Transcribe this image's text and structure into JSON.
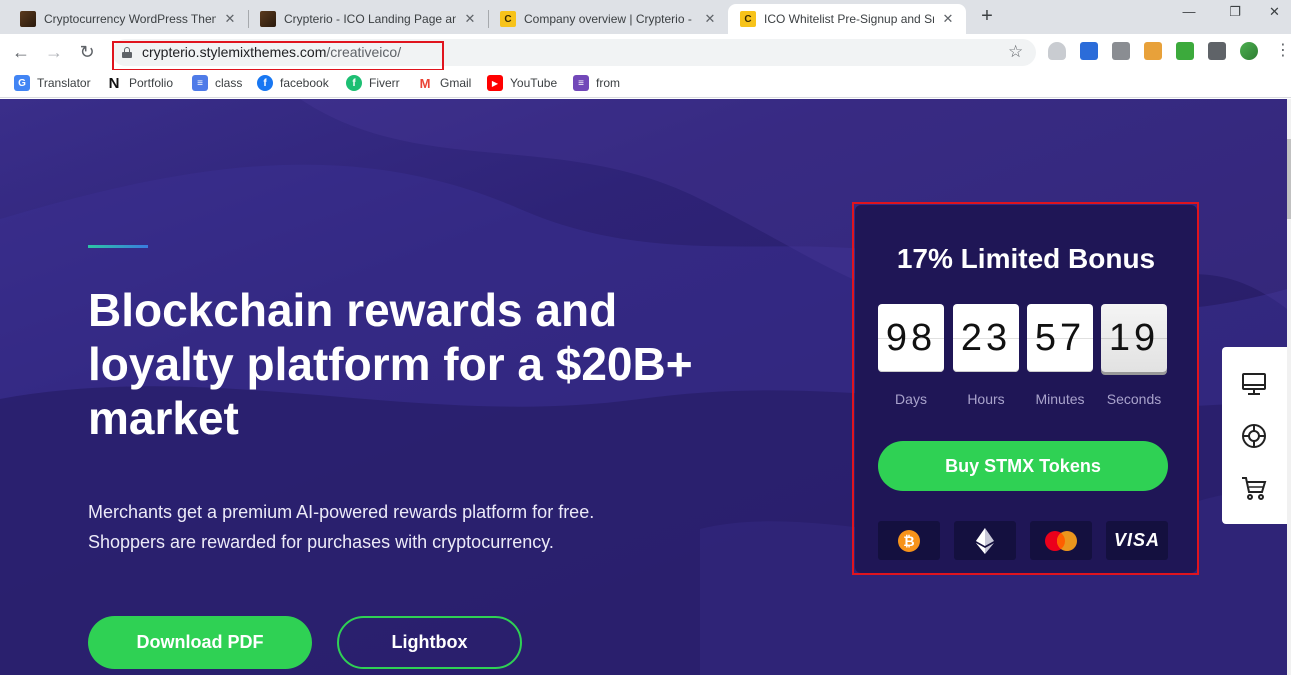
{
  "browser": {
    "tabs": [
      {
        "title": "Cryptocurrency WordPress Them",
        "favicon": "dark-logo-icon",
        "active": false
      },
      {
        "title": "Crypterio - ICO Landing Page and",
        "favicon": "dark-logo-icon",
        "active": false
      },
      {
        "title": "Company overview | Crypterio - I",
        "favicon": "coin-icon",
        "active": false
      },
      {
        "title": "ICO Whitelist Pre-Signup and Sm",
        "favicon": "coin-icon",
        "active": true
      }
    ],
    "address": {
      "host": "crypterio.stylemixthemes.com",
      "path": "/creativeico/"
    },
    "bookmarks": [
      {
        "label": "Translator",
        "icon": "google-translate-icon",
        "color": "#4285f4"
      },
      {
        "label": "Portfolio",
        "icon": "n-icon",
        "color": "#111111"
      },
      {
        "label": "class",
        "icon": "docs-icon",
        "color": "#4f7be8"
      },
      {
        "label": "facebook",
        "icon": "facebook-icon",
        "color": "#1877f2"
      },
      {
        "label": "Fiverr",
        "icon": "fiverr-icon",
        "color": "#1dbf73"
      },
      {
        "label": "Gmail",
        "icon": "gmail-icon",
        "color": "#ea4335"
      },
      {
        "label": "YouTube",
        "icon": "youtube-icon",
        "color": "#ff0000"
      },
      {
        "label": "from",
        "icon": "forms-icon",
        "color": "#7248b9"
      }
    ]
  },
  "hero": {
    "headline": "Blockchain rewards and loyalty platform for a $20B+ market",
    "subtext_line1": "Merchants get a premium AI-powered rewards platform for free.",
    "subtext_line2": "Shoppers are rewarded for purchases with cryptocurrency.",
    "download_label": "Download PDF",
    "lightbox_label": "Lightbox"
  },
  "bonus": {
    "title": "17% Limited Bonus",
    "countdown": [
      {
        "value": "98",
        "label": "Days"
      },
      {
        "value": "23",
        "label": "Hours"
      },
      {
        "value": "57",
        "label": "Minutes"
      },
      {
        "value": "19",
        "label": "Seconds"
      }
    ],
    "buy_label": "Buy STMX Tokens",
    "payment_methods": [
      "bitcoin-icon",
      "ethereum-icon",
      "mastercard-icon",
      "VISA"
    ]
  },
  "colors": {
    "accent_green": "#2fd154",
    "highlight_red": "#e0141e",
    "page_bg": "#2a1f6c"
  }
}
